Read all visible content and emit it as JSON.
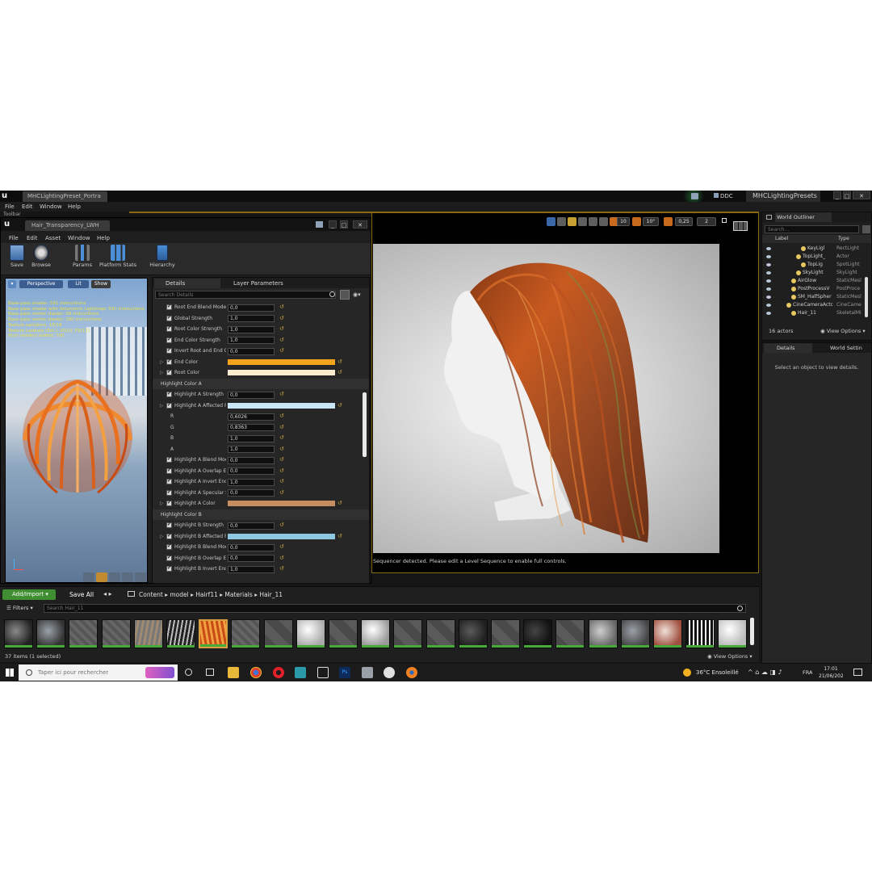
{
  "app": {
    "tab_title": "MHCLightingPreset_Portra",
    "project_name": "MHCLightingPresets",
    "ddc_label": "DDC",
    "menu": [
      "File",
      "Edit",
      "Window",
      "Help"
    ],
    "toolbar_label": "Toolbar"
  },
  "material_editor": {
    "tab_title": "Hair_Transparency_LWH",
    "menu": [
      "File",
      "Edit",
      "Asset",
      "Window",
      "Help"
    ],
    "toolbar": [
      "Save",
      "Browse",
      "Params",
      "Platform Stats",
      "Hierarchy"
    ],
    "preview": {
      "view_mode": "Perspective",
      "lit_mode": "Lit",
      "show_label": "Show",
      "stats": [
        "Base pass shader: 591 instructions",
        "Base pass shader with Volumetric Lightmap: 591 instructions",
        "Base pass vertex shader: 58 instructions",
        "Base pass vertex shader: 160 instructions",
        "Texture samplers: 10/16",
        "Texture Lookups (Est.): VS(0), PS(12)",
        "Num shaders added: 700"
      ]
    },
    "details": {
      "tab_details": "Details",
      "tab_layers": "Layer Parameters",
      "search_placeholder": "Search Details",
      "rows": [
        {
          "type": "param",
          "label": "Root End Blend Mode",
          "value": "0,0"
        },
        {
          "type": "param",
          "label": "Global Strength",
          "value": "1,0"
        },
        {
          "type": "param",
          "label": "Root Color Strength",
          "value": "1,0"
        },
        {
          "type": "param",
          "label": "End Color Strength",
          "value": "1,0"
        },
        {
          "type": "param",
          "label": "Invert Root and End Col",
          "value": "0,0"
        },
        {
          "type": "color",
          "label": "End Color",
          "color": "#f4a41c"
        },
        {
          "type": "color",
          "label": "Root Color",
          "color": "#fbecd0"
        },
        {
          "type": "section",
          "label": "Highlight Color A"
        },
        {
          "type": "param",
          "label": "Highlight A Strength",
          "value": "0,0"
        },
        {
          "type": "color",
          "label": "Highlight A Affected Ra",
          "color": "#c9e6f7"
        },
        {
          "type": "sub",
          "label": "R",
          "value": "0,6026"
        },
        {
          "type": "sub",
          "label": "G",
          "value": "0,8363"
        },
        {
          "type": "sub",
          "label": "B",
          "value": "1,0"
        },
        {
          "type": "sub",
          "label": "A",
          "value": "1,0"
        },
        {
          "type": "param",
          "label": "Highlight A Blend Mode",
          "value": "0,0"
        },
        {
          "type": "param",
          "label": "Highlight A Overlap Enc",
          "value": "0,0"
        },
        {
          "type": "param",
          "label": "Highlight A Invert End I",
          "value": "1,0"
        },
        {
          "type": "param",
          "label": "Highlight A Specular St",
          "value": "0,0"
        },
        {
          "type": "color",
          "label": "Highlight A Color",
          "color": "#c58d60"
        },
        {
          "type": "section",
          "label": "Highlight Color B"
        },
        {
          "type": "param",
          "label": "Highlight B Strength",
          "value": "0,0"
        },
        {
          "type": "color",
          "label": "Highlight B Affected Ra",
          "color": "#8ec8e0"
        },
        {
          "type": "param",
          "label": "Highlight B Blend Mode",
          "value": "0,0"
        },
        {
          "type": "param",
          "label": "Highlight B Overlap Enc",
          "value": "0,0"
        },
        {
          "type": "param",
          "label": "Highlight B Invert End I",
          "value": "1,0"
        }
      ]
    }
  },
  "viewport": {
    "buttons": [
      "10",
      "10°",
      "0,25",
      "2"
    ],
    "message": "Sequencer detected. Please edit a Level Sequence to enable full controls."
  },
  "outliner": {
    "title": "World Outliner",
    "search_placeholder": "Search...",
    "col_label": "Label",
    "col_type": "Type",
    "rows": [
      {
        "label": "KeyLigl",
        "type": "RectLight",
        "indent": 3
      },
      {
        "label": "TopLight_",
        "type": "Actor",
        "indent": 2
      },
      {
        "label": "TopLig",
        "type": "SpotLight",
        "indent": 3
      },
      {
        "label": "SkyLight",
        "type": "SkyLight",
        "indent": 2
      },
      {
        "label": "AirGlow",
        "type": "StaticMesl",
        "indent": 1
      },
      {
        "label": "PostProcessV",
        "type": "PostProce",
        "indent": 1
      },
      {
        "label": "SM_HalfSpher",
        "type": "StaticMesl",
        "indent": 1
      },
      {
        "label": "CineCameraActc",
        "type": "CineCame",
        "indent": 0
      },
      {
        "label": "Hair_11",
        "type": "SkeletalMi",
        "indent": 1
      }
    ],
    "count": "16 actors",
    "view_options": "View Options"
  },
  "right_details": {
    "tab_details": "Details",
    "tab_world": "World Settin",
    "empty_msg": "Select an object to view details."
  },
  "content_browser": {
    "add_import": "Add/Import",
    "save_all": "Save All",
    "breadcrumb": [
      "Content",
      "model",
      "Hairf11",
      "Materials",
      "Hair_11"
    ],
    "filters": "Filters",
    "search_placeholder": "Search Hair_11",
    "items_status": "37 items (1 selected)",
    "view_options": "View Options"
  },
  "taskbar": {
    "search_placeholder": "Taper ici pour rechercher",
    "weather": "36°C  Ensoleillé",
    "lang": "FRA",
    "time": "17:01",
    "date": "21/06/2022"
  }
}
